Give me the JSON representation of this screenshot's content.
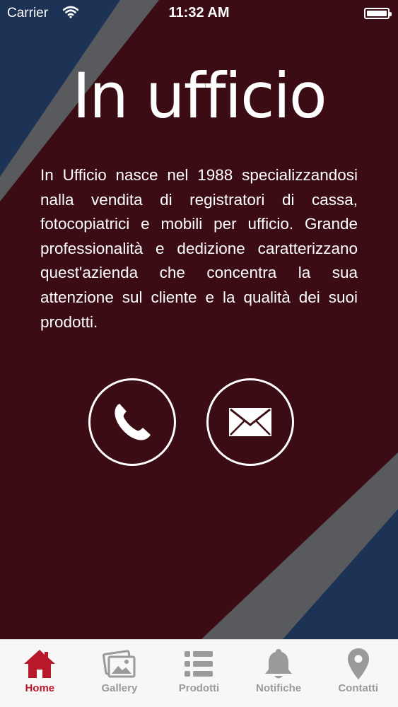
{
  "status_bar": {
    "carrier": "Carrier",
    "time": "11:32 AM",
    "icons": [
      "wifi-icon",
      "battery-icon"
    ]
  },
  "hero": {
    "logo_text": "In ufficio",
    "description": "In Ufficio nasce nel 1988 specializzandosi nalla vendita di registratori di cassa, fotocopiatrici e mobili per ufficio. Grande professionalità e dedizione caratterizzano quest'azienda che concentra la sua attenzione sul cliente e la qualità dei suoi prodotti."
  },
  "actions": {
    "call_icon": "phone-icon",
    "mail_icon": "envelope-icon"
  },
  "tab_bar": {
    "tabs": [
      {
        "label": "Home",
        "icon": "home-icon",
        "active": true
      },
      {
        "label": "Gallery",
        "icon": "gallery-icon",
        "active": false
      },
      {
        "label": "Prodotti",
        "icon": "list-icon",
        "active": false
      },
      {
        "label": "Notifiche",
        "icon": "bell-icon",
        "active": false
      },
      {
        "label": "Contatti",
        "icon": "location-pin-icon",
        "active": false
      }
    ]
  },
  "colors": {
    "panel": "#3b0c14",
    "stripe": "#5a5a5c",
    "corner": "#1d3355",
    "accent": "#b8192a",
    "inactive": "#9a9a9a"
  }
}
